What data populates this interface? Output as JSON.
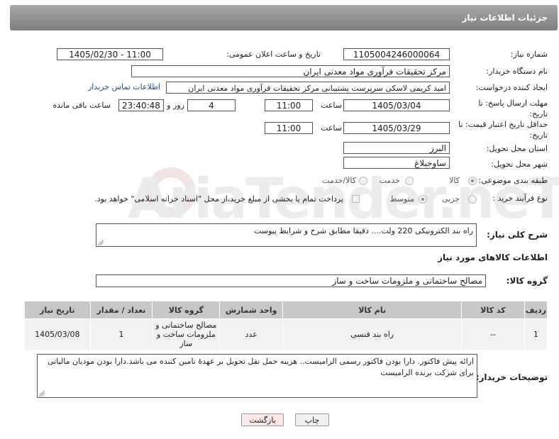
{
  "header": {
    "title": "جزئیات اطلاعات نیاز"
  },
  "fields": {
    "need_number_label": "شماره نیاز:",
    "need_number": "1105004246000064",
    "announce_label": "تاریخ و ساعت اعلان عمومی:",
    "announce_value": "1405/02/30 - 11:00",
    "buyer_org_label": "نام دستگاه خریدار:",
    "buyer_org": "مرکز تحقیقات فرآوری مواد معدنی ایران",
    "requester_label": "ایجاد کننده درخواست:",
    "requester": "امید کریمی لاسکی سرپرست پشتیبانی مرکز تحقیقات فرآوری مواد معدنی ایران",
    "contact_link": "اطلاعات تماس خریدار",
    "reply_deadline_label": "مهلت ارسال پاسخ: تا تاریخ:",
    "reply_date": "1405/03/04",
    "time_label": "ساعت",
    "reply_time": "11:00",
    "days_value": "4",
    "days_label": "روز و",
    "remaining_value": "23:40:48",
    "remaining_label": "ساعت باقی مانده",
    "price_deadline_label": "حداقل تاریخ اعتبار قیمت: تا تاریخ:",
    "price_date": "1405/03/29",
    "price_time": "11:00",
    "province_label": "استان محل تحویل:",
    "province": "البرز",
    "city_label": "شهر محل تحویل:",
    "city": "ساوجبلاغ",
    "category_label": "طبقه بندی موضوعی:",
    "category_options": [
      "کالا",
      "خدمت",
      "کالا/خدمت"
    ],
    "process_label": "نوع فرآیند خرید :",
    "process_options": [
      "جزیی",
      "متوسط"
    ],
    "payment_note": "پرداخت تمام یا بخشی از مبلغ خرید،از محل \"اسناد خزانه اسلامی\" خواهد بود."
  },
  "description": {
    "label": "شرح کلی نیاز:",
    "text": "راه بند الکترونیکی 220 ولت.... دقیقا مطابق شرح و شرایط پیوست"
  },
  "goods": {
    "section_title": "اطلاعات کالاهای مورد نیاز",
    "group_label": "گروه کالا:",
    "group_value": "مصالح ساختمانی و ملزومات ساخت و ساز",
    "columns": [
      "ردیف",
      "کد کالا",
      "نام کالا",
      "واحد شمارش",
      "گروه کالا",
      "تعداد / مقدار",
      "تاریخ نیاز"
    ],
    "rows": [
      [
        "1",
        "--",
        "راه بند فنسی",
        "عدد",
        "مصالح ساختمانی و ملزومات ساخت و ساز",
        "1",
        "1405/03/08"
      ]
    ]
  },
  "buyer_notes": {
    "label": "توضیحات خریدار:",
    "text": "ارائه پیش فاکتور. دارا بودن فاکتور رسمی الزامیست.. هزینه حمل نقل تحویل بر عهدهٔ تامین کننده می باشد.دارا بودن مودیان مالیاتی برای شرکت برنده الزامیست"
  },
  "buttons": {
    "print": "چاپ",
    "back": "بازگشت"
  },
  "watermark": "AriaTender.neT",
  "colors": {
    "link": "#1a4fa0",
    "back_button": "#fbe9e9",
    "print_button": "#f0f0f0"
  }
}
